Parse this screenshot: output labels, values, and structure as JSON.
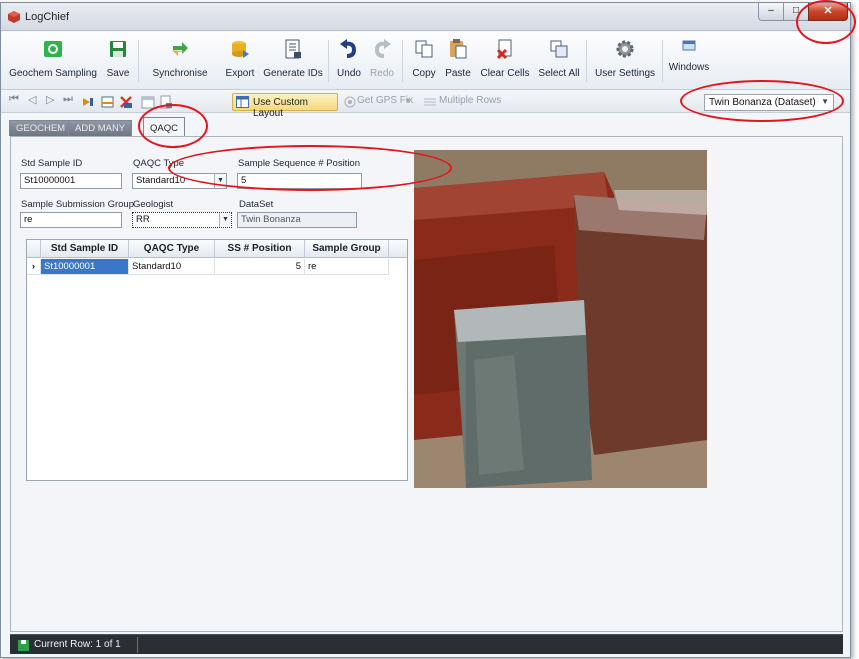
{
  "window": {
    "title": "LogChief",
    "controls": {
      "minimize": "–",
      "maximize": "□",
      "close": "✕"
    }
  },
  "ribbon": {
    "buttons": [
      {
        "label": "Geochem Sampling",
        "icon": "geochem-sampling-icon"
      },
      {
        "label": "Save",
        "icon": "save-icon"
      },
      {
        "label": "Synchronise",
        "icon": "synchronise-icon"
      },
      {
        "label": "Export",
        "icon": "export-icon"
      },
      {
        "label": "Generate IDs",
        "icon": "generate-ids-icon"
      },
      {
        "label": "Undo",
        "icon": "undo-icon"
      },
      {
        "label": "Redo",
        "icon": "redo-icon"
      },
      {
        "label": "Copy",
        "icon": "copy-icon"
      },
      {
        "label": "Paste",
        "icon": "paste-icon"
      },
      {
        "label": "Clear Cells",
        "icon": "clear-cells-icon"
      },
      {
        "label": "Select All",
        "icon": "select-all-icon"
      },
      {
        "label": "User Settings",
        "icon": "gear-icon"
      },
      {
        "label": "Windows",
        "icon": "windows-icon"
      }
    ]
  },
  "toolbar": {
    "custom_layout": "Use Custom Layout",
    "gps_fix": "Get GPS Fix",
    "multiple_rows": "Multiple Rows",
    "dataset": "Twin Bonanza  (Dataset)"
  },
  "tabs": [
    "GEOCHEM",
    "ADD MANY",
    "QAQC"
  ],
  "form": {
    "std_sample_id": {
      "label": "Std Sample ID",
      "value": "St10000001"
    },
    "qaqc_type": {
      "label": "QAQC Type",
      "value": "Standard10"
    },
    "sample_sequence": {
      "label": "Sample Sequence # Position",
      "value": "5"
    },
    "submission_group": {
      "label": "Sample Submission Group",
      "value": "re"
    },
    "geologist": {
      "label": "Geologist",
      "value": "RR"
    },
    "dataset": {
      "label": "DataSet",
      "value": "Twin Bonanza"
    }
  },
  "grid": {
    "columns": [
      "Std Sample ID",
      "QAQC Type",
      "SS # Position",
      "Sample Group"
    ],
    "rows": [
      {
        "indicator": "›",
        "cells": [
          "St10000001",
          "Standard10",
          "5",
          "re"
        ]
      }
    ]
  },
  "status": {
    "text": "Current Row: 1 of 1"
  },
  "colors": {
    "annotation": "#e2161e",
    "status_bar": "#2a2e35",
    "selection": "#3a77c8"
  }
}
